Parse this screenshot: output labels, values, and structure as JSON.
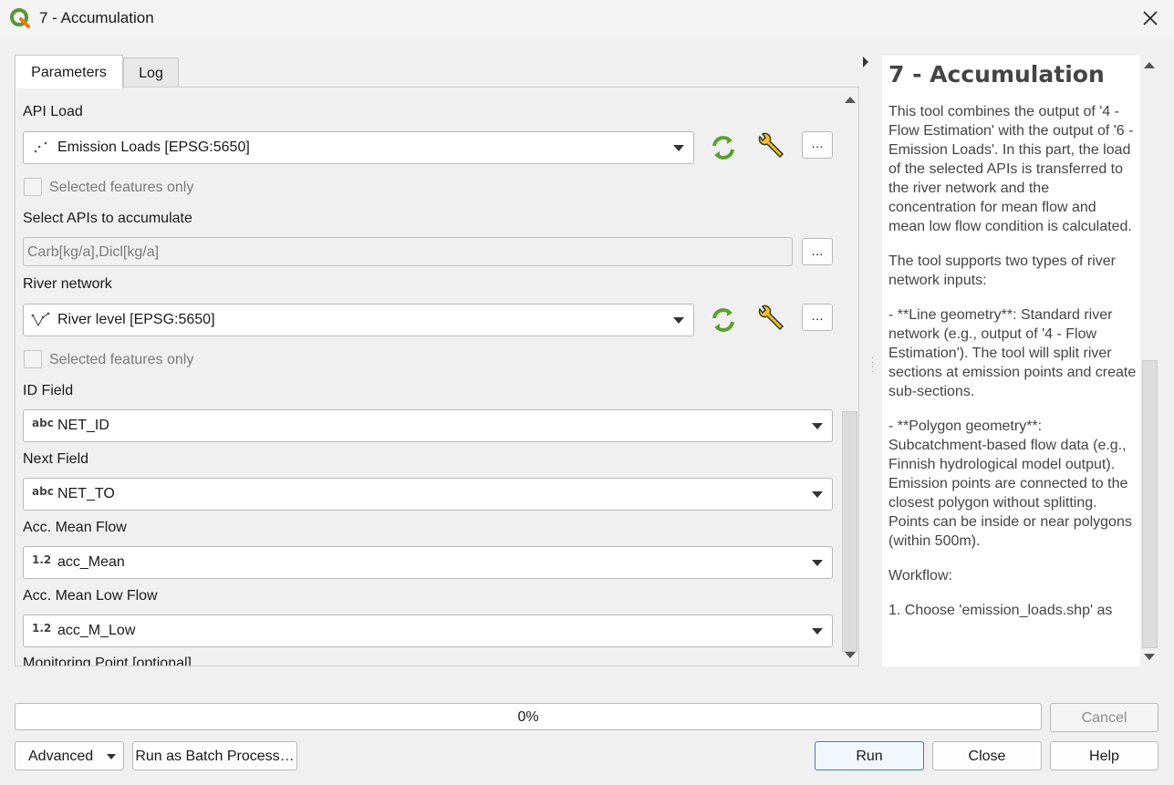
{
  "window": {
    "title": "7 - Accumulation",
    "app_icon": "qgis-icon",
    "close_icon": "close-icon"
  },
  "tabs": [
    {
      "label": "Parameters",
      "active": true
    },
    {
      "label": "Log",
      "active": false
    }
  ],
  "params": {
    "api_load_label": "API Load",
    "api_load_value": "Emission Loads [EPSG:5650]",
    "api_load_icon": "point-layer-icon",
    "selected_only_label_1": "Selected features only",
    "select_apis_label": "Select APIs to accumulate",
    "select_apis_value": "Carb[kg/a],Dicl[kg/a]",
    "river_label": "River network",
    "river_value": "River level [EPSG:5650]",
    "river_icon": "line-layer-icon",
    "selected_only_label_2": "Selected features only",
    "id_field_label": "ID Field",
    "id_field_type": "abc",
    "id_field_value": "NET_ID",
    "next_field_label": "Next Field",
    "next_field_type": "abc",
    "next_field_value": "NET_TO",
    "acc_mean_label": "Acc. Mean Flow",
    "acc_mean_type": "1.2",
    "acc_mean_value": "acc_Mean",
    "acc_low_label": "Acc. Mean Low Flow",
    "acc_low_type": "1.2",
    "acc_low_value": "acc_M_Low",
    "monitoring_label": "Monitoring Point [optional]",
    "dots": "…"
  },
  "help": {
    "title": "7 - Accumulation",
    "paragraphs": [
      "This tool combines the output of '4 - Flow Estimation' with the output of '6 - Emission Loads'. In this part, the load of the selected APIs is transferred to the river network and the concentration for mean flow and mean low flow condition is calculated.",
      "The tool supports two types of river network inputs:",
      "- **Line geometry**: Standard river network (e.g., output of '4 - Flow Estimation'). The tool will split river sections at emission points and create sub-sections.",
      "- **Polygon geometry**: Subcatchment-based flow data (e.g., Finnish hydrological model output). Emission points are connected to the closest polygon without splitting. Points can be inside or near polygons (within 500m).",
      "Workflow:",
      "1. Choose 'emission_loads.shp' as"
    ]
  },
  "progress": {
    "value": 0,
    "text": "0%"
  },
  "buttons": {
    "cancel": "Cancel",
    "advanced": "Advanced",
    "batch": "Run as Batch Process…",
    "run": "Run",
    "close": "Close",
    "help": "Help"
  },
  "colors": {
    "refresh_icon": "#5aa02c",
    "wrench_icon": "#d4a017",
    "run_border": "#3b79c6"
  }
}
